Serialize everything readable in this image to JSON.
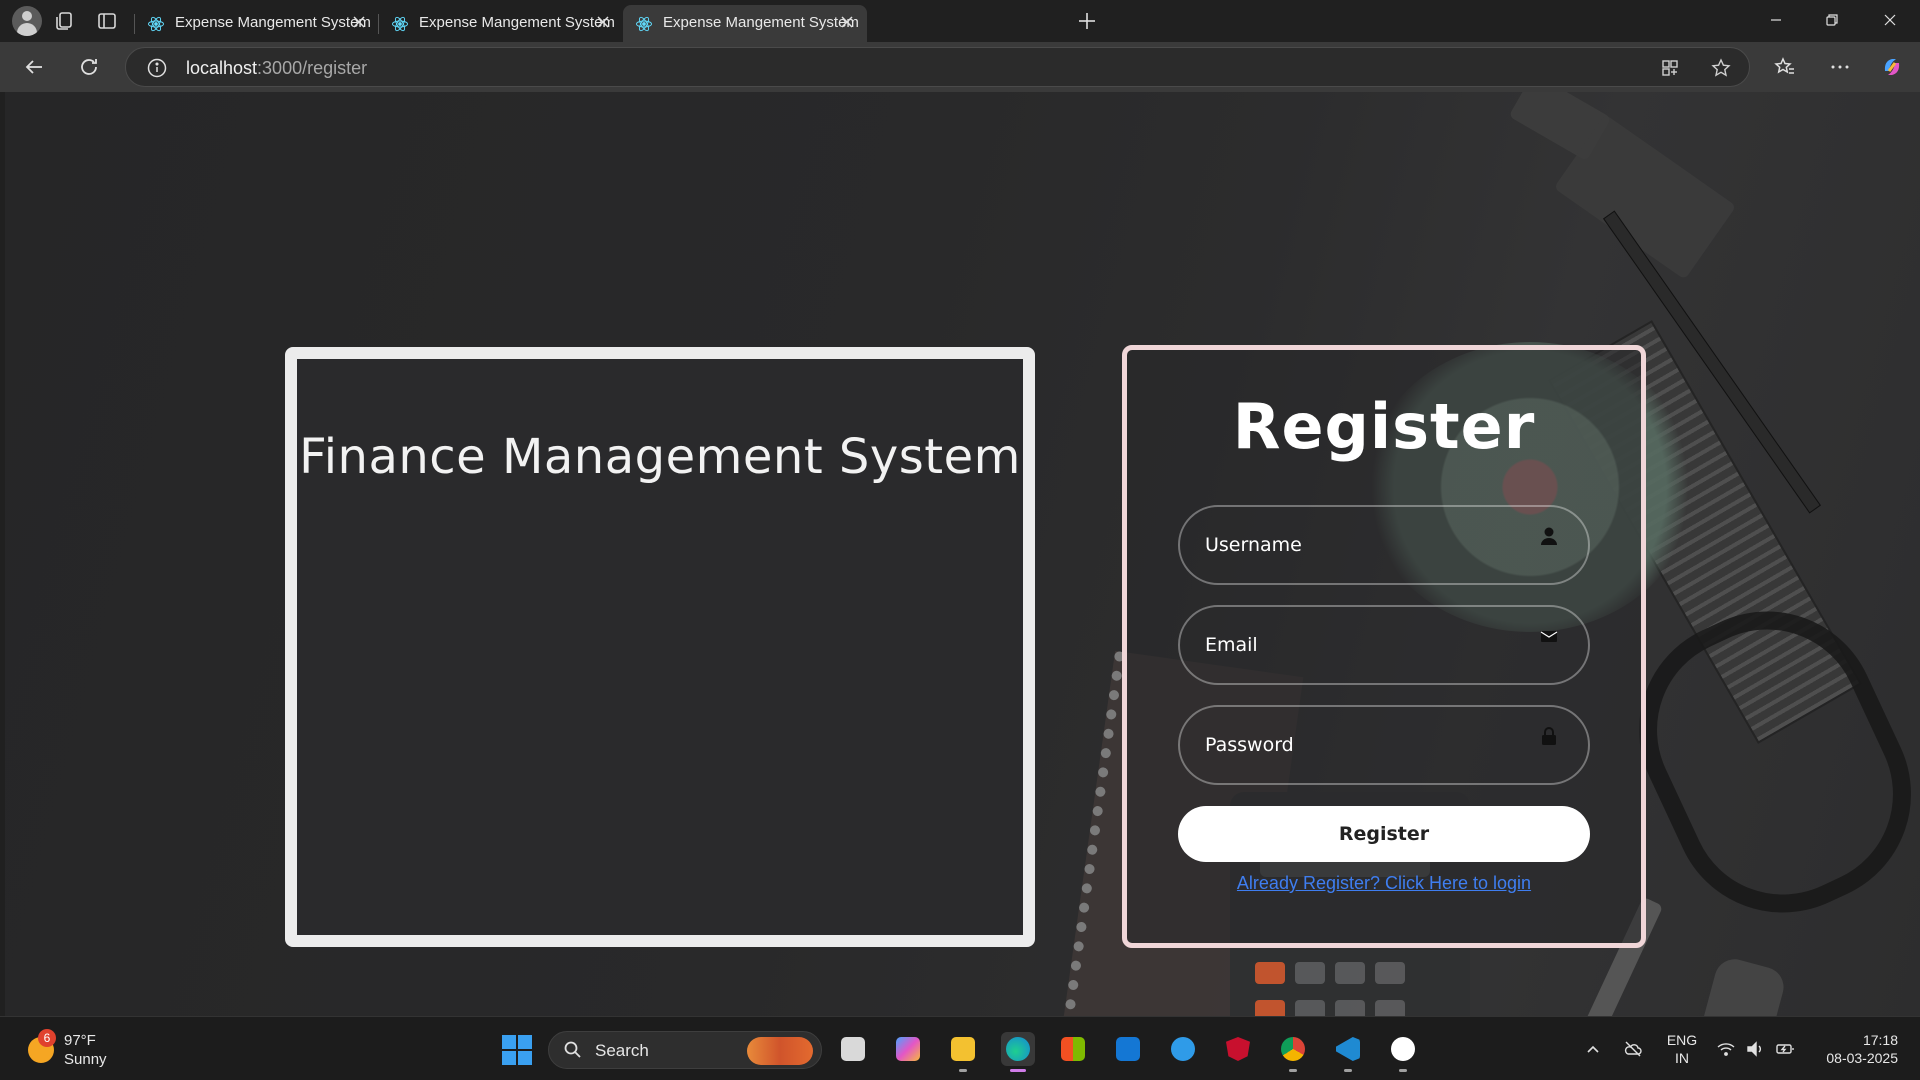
{
  "browser": {
    "tabs": [
      {
        "title": "Expense Mangement System",
        "active": false
      },
      {
        "title": "Expense Mangement System",
        "active": false
      },
      {
        "title": "Expense Mangement System",
        "active": true
      }
    ],
    "address": {
      "host": "localhost",
      "path": ":3000/register"
    }
  },
  "page": {
    "left_card": {
      "title": "Finance Management System"
    },
    "register": {
      "title": "Register",
      "username_placeholder": "Username",
      "email_placeholder": "Email",
      "password_placeholder": "Password",
      "button_label": "Register",
      "login_link": "Already Register? Click Here to login"
    }
  },
  "taskbar": {
    "weather": {
      "temp": "97°F",
      "condition": "Sunny",
      "badge": "6"
    },
    "search_label": "Search",
    "lang_line1": "ENG",
    "lang_line2": "IN",
    "time": "17:18",
    "date": "08-03-2025"
  },
  "colors": {
    "card_border_left": "#ececec",
    "card_border_register": "#f0d6d8",
    "link": "#3f7ef0",
    "react_icon": "#61dafb"
  }
}
